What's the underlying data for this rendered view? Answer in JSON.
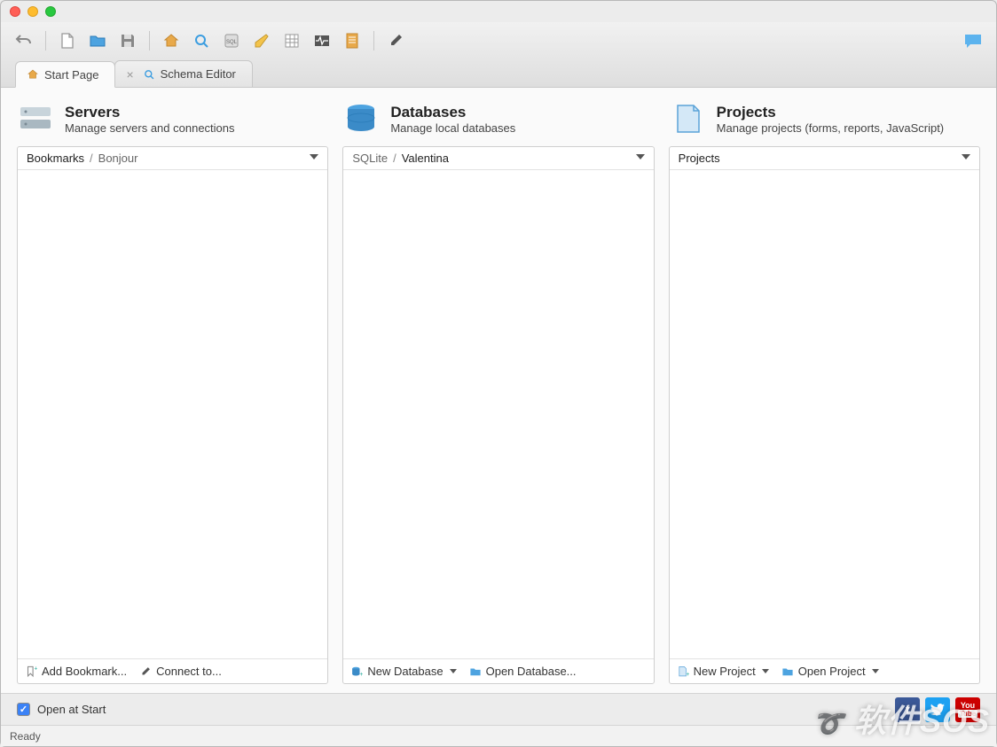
{
  "tabs": {
    "start_page": "Start Page",
    "schema_editor": "Schema Editor"
  },
  "columns": {
    "servers": {
      "title": "Servers",
      "subtitle": "Manage servers and connections",
      "crumb1": "Bookmarks",
      "crumb2": "Bonjour",
      "foot_add": "Add Bookmark...",
      "foot_connect": "Connect to..."
    },
    "databases": {
      "title": "Databases",
      "subtitle": "Manage local databases",
      "crumb1": "SQLite",
      "crumb2": "Valentina",
      "foot_new": "New Database",
      "foot_open": "Open Database..."
    },
    "projects": {
      "title": "Projects",
      "subtitle": "Manage projects (forms, reports, JavaScript)",
      "crumb1": "Projects",
      "foot_new": "New Project",
      "foot_open": "Open Project"
    }
  },
  "footer": {
    "open_at_start": "Open at Start"
  },
  "status": "Ready",
  "watermark": "软件SOS"
}
